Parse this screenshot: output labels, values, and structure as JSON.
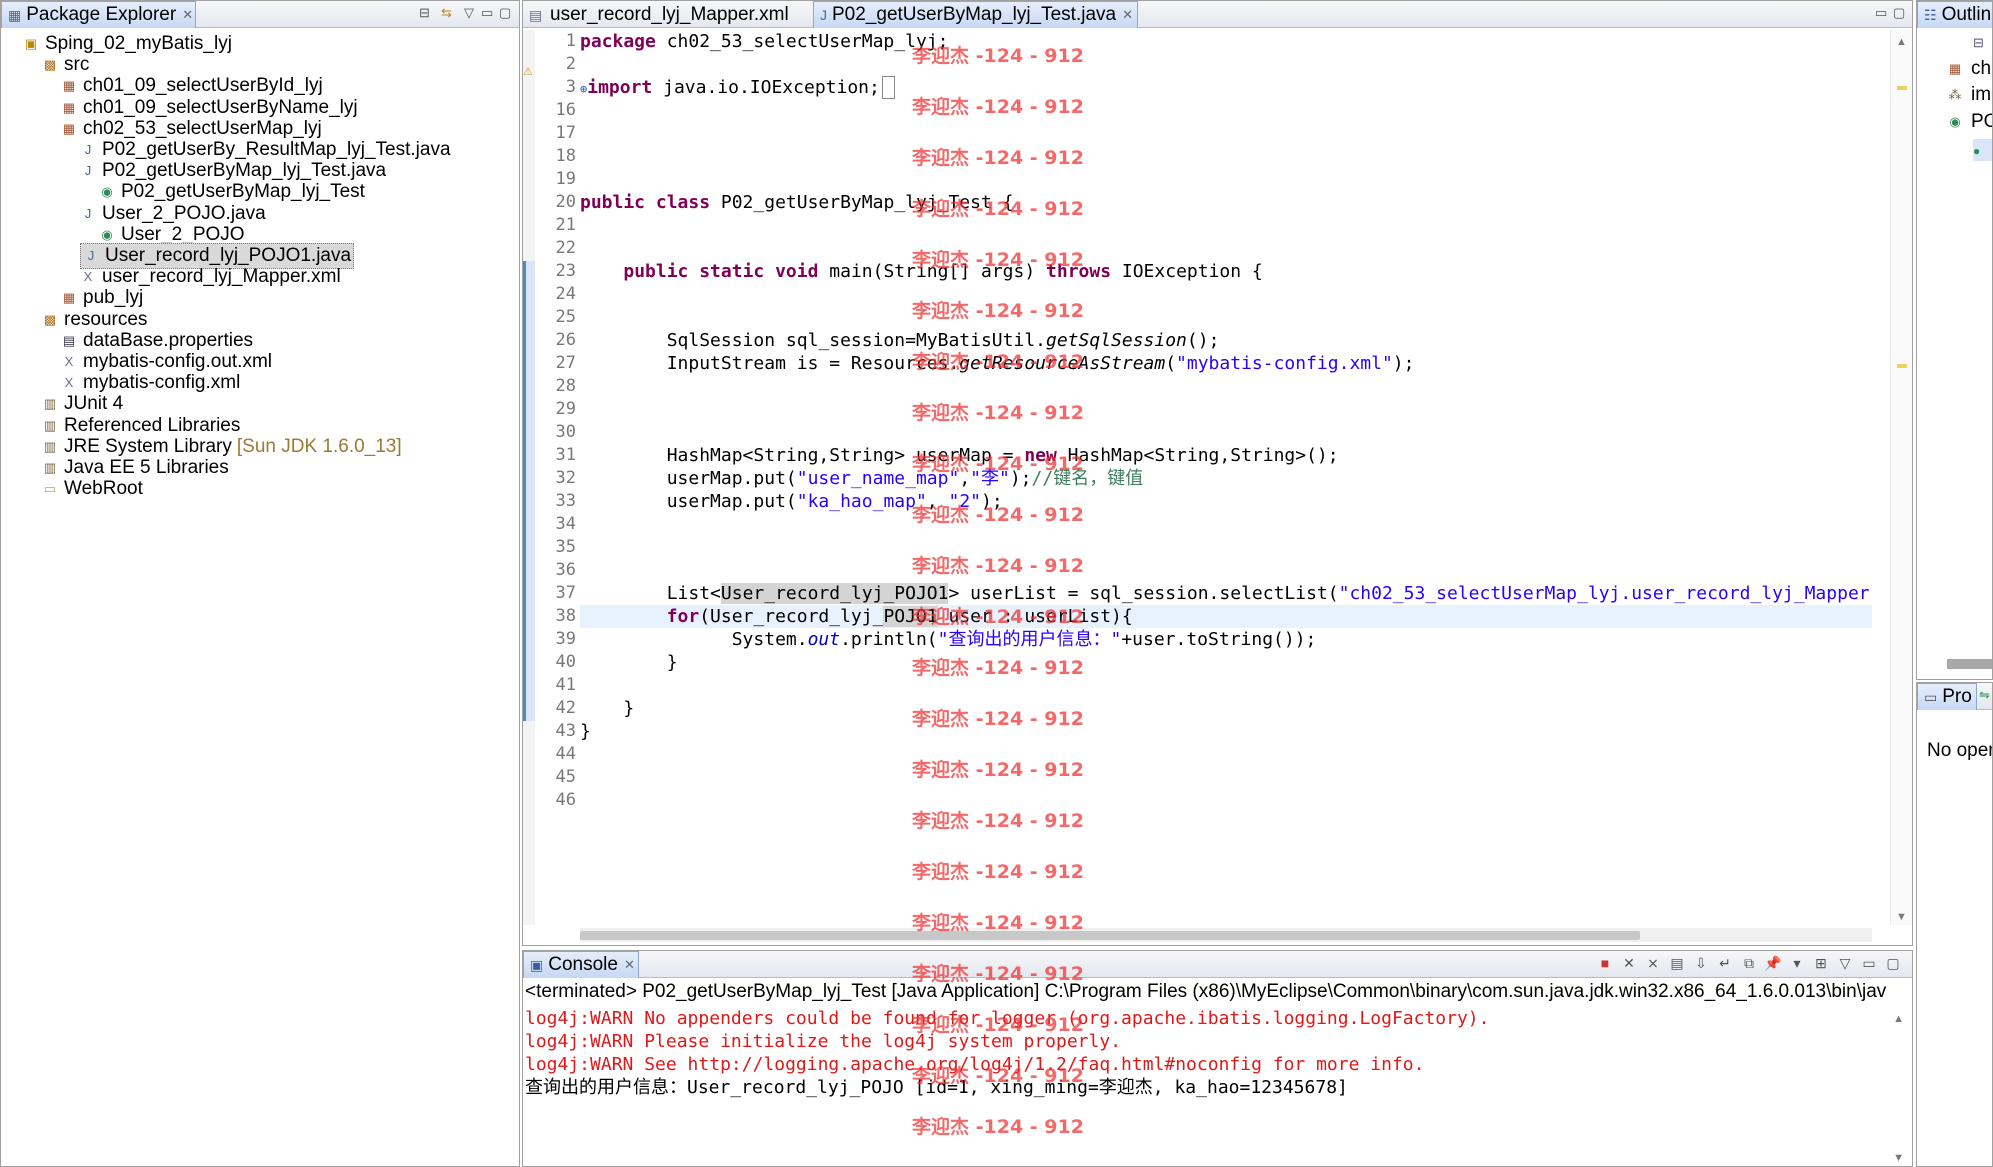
{
  "package_explorer": {
    "title": "Package Explorer",
    "items": [
      {
        "label": "Sping_02_myBatis_lyj",
        "icon": "project-icon",
        "indent": 0
      },
      {
        "label": "src",
        "icon": "source-folder-icon",
        "indent": 1
      },
      {
        "label": "ch01_09_selectUserById_lyj",
        "icon": "package-icon",
        "indent": 2
      },
      {
        "label": "ch01_09_selectUserByName_lyj",
        "icon": "package-icon",
        "indent": 2
      },
      {
        "label": "ch02_53_selectUserMap_lyj",
        "icon": "package-icon",
        "indent": 2
      },
      {
        "label": "P02_getUserBy_ResultMap_lyj_Test.java",
        "icon": "java-file-icon",
        "indent": 3
      },
      {
        "label": "P02_getUserByMap_lyj_Test.java",
        "icon": "java-file-icon",
        "indent": 3
      },
      {
        "label": "P02_getUserByMap_lyj_Test",
        "icon": "class-icon",
        "indent": 4
      },
      {
        "label": "User_2_POJO.java",
        "icon": "java-file-icon",
        "indent": 3
      },
      {
        "label": "User_2_POJO",
        "icon": "class-icon",
        "indent": 4
      },
      {
        "label": "User_record_lyj_POJO1.java",
        "icon": "java-file-icon",
        "indent": 3,
        "selected": true
      },
      {
        "label": "user_record_lyj_Mapper.xml",
        "icon": "xml-file-icon",
        "indent": 3
      },
      {
        "label": "pub_lyj",
        "icon": "package-icon",
        "indent": 2
      },
      {
        "label": "resources",
        "icon": "source-folder-icon",
        "indent": 1
      },
      {
        "label": "dataBase.properties",
        "icon": "properties-file-icon",
        "indent": 2
      },
      {
        "label": "mybatis-config.out.xml",
        "icon": "xml-file-icon",
        "indent": 2
      },
      {
        "label": "mybatis-config.xml",
        "icon": "xml-file-icon",
        "indent": 2
      },
      {
        "label": "JUnit 4",
        "icon": "library-icon",
        "indent": 1
      },
      {
        "label": "Referenced Libraries",
        "icon": "library-icon",
        "indent": 1
      },
      {
        "label": "JRE System Library",
        "icon": "library-icon",
        "indent": 1,
        "decoration": "[Sun JDK 1.6.0_13]"
      },
      {
        "label": "Java EE 5 Libraries",
        "icon": "library-icon",
        "indent": 1
      },
      {
        "label": "WebRoot",
        "icon": "folder-icon",
        "indent": 1
      }
    ]
  },
  "editor": {
    "tabs": [
      {
        "label": "user_record_lyj_Mapper.xml",
        "active": false
      },
      {
        "label": "P02_getUserByMap_lyj_Test.java",
        "active": true
      }
    ],
    "line_numbers": [
      "1",
      "2",
      "3",
      "16",
      "17",
      "18",
      "19",
      "20",
      "21",
      "22",
      "23",
      "24",
      "25",
      "26",
      "27",
      "28",
      "29",
      "30",
      "31",
      "32",
      "33",
      "34",
      "35",
      "36",
      "37",
      "38",
      "39",
      "40",
      "41",
      "42",
      "43",
      "44",
      "45",
      "46"
    ],
    "code": {
      "l1_kw": "package",
      "l1_rest": " ch02_53_selectUserMap_lyj;",
      "l3_kw": "import",
      "l3_rest": " java.io.IOException;",
      "l20_kw": "public class",
      "l20_rest": " P02_getUserByMap_lyj_Test {",
      "l23_pre": "    ",
      "l23_kw": "public static void",
      "l23_mid": " main(String[] args) ",
      "l23_kw2": "throws",
      "l23_rest": " IOException {",
      "l26_a": "        SqlSession sql_session=MyBatisUtil.",
      "l26_it": "getSqlSession",
      "l26_b": "();",
      "l27_a": "        InputStream is = Resources.",
      "l27_it": "getResourceAsStream",
      "l27_b": "(",
      "l27_str": "\"mybatis-config.xml\"",
      "l27_c": ");",
      "l31_a": "        HashMap<String,String> userMap = ",
      "l31_kw": "new",
      "l31_b": " HashMap<String,String>();",
      "l32_a": "        userMap.put(",
      "l32_s1": "\"user_name_map\"",
      "l32_b": ",",
      "l32_s2": "\"李\"",
      "l32_c": ");",
      "l32_cmt": "//键名，键值",
      "l33_a": "        userMap.put(",
      "l33_s1": "\"ka_hao_map\"",
      "l33_b": ", ",
      "l33_s2": "\"2\"",
      "l33_c": ");",
      "l37_a": "        List<",
      "l37_hl": "User_record_lyj_POJO1",
      "l37_b": "> userList = sql_session.selectList(",
      "l37_str": "\"ch02_53_selectUserMap_lyj.user_record_lyj_Mapper",
      "l38_pre": "        ",
      "l38_kw": "for",
      "l38_a": "(User_record_lyj_",
      "l38_hl": "POJO1",
      "l38_b": " user : userList){",
      "l39_a": "              System.",
      "l39_fld": "out",
      "l39_b": ".println(",
      "l39_str": "\"查询出的用户信息：\"",
      "l39_c": "+user.toString());",
      "l40": "        }",
      "l42": "    }",
      "l43": "}"
    }
  },
  "console": {
    "title": "Console",
    "status": "<terminated> P02_getUserByMap_lyj_Test [Java Application] C:\\Program Files (x86)\\MyEclipse\\Common\\binary\\com.sun.java.jdk.win32.x86_64_1.6.0.013\\bin\\jav",
    "lines": [
      {
        "text": "log4j:WARN No appenders could be found for logger (org.apache.ibatis.logging.LogFactory).",
        "type": "err"
      },
      {
        "text": "log4j:WARN Please initialize the log4j system properly.",
        "type": "err"
      },
      {
        "text": "log4j:WARN See http://logging.apache.org/log4j/1.2/faq.html#noconfig for more info.",
        "type": "err"
      },
      {
        "text": "查询出的用户信息：User_record_lyj_POJO [id=1, xing_ming=李迎杰, ka_hao=12345678]",
        "type": "out"
      }
    ]
  },
  "outline": {
    "title": "Outlin",
    "items": [
      "ch",
      "im",
      "PO"
    ]
  },
  "properties": {
    "title": "Pro",
    "message": "No oper"
  },
  "watermark": {
    "text": "李迎杰 -124 - 912"
  }
}
